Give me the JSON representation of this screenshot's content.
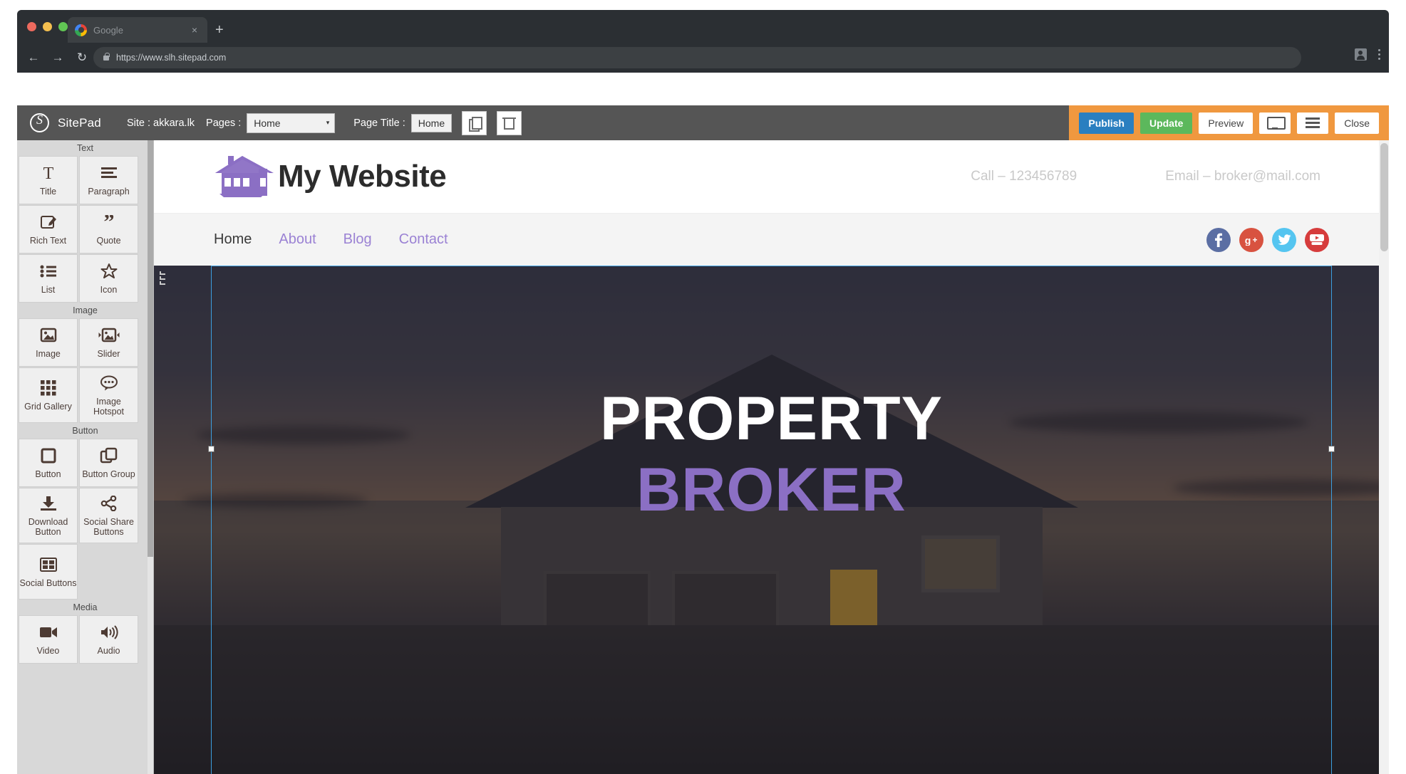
{
  "browser": {
    "tab": {
      "title": "Google",
      "favicon": "google-icon",
      "close": "×"
    },
    "new_tab": "+",
    "back": "←",
    "forward": "→",
    "reload": "↻",
    "url": "https://www.slh.sitepad.com"
  },
  "editor": {
    "brand": "SitePad",
    "site_label": "Site : akkara.lk",
    "pages_label": "Pages :",
    "page_select": {
      "value": "Home",
      "caret": "▾"
    },
    "page_title_label": "Page Title :",
    "page_title_value": "Home",
    "duplicate_icon": "copy-icon",
    "delete_icon": "trash-icon",
    "actions": {
      "publish": "Publish",
      "update": "Update",
      "preview": "Preview",
      "device_icon": "monitor-icon",
      "menu_icon": "hamburger-icon",
      "close": "Close"
    },
    "accent_orange": "#f0983f",
    "publish_color": "#2a7fc0",
    "update_color": "#5cb85c"
  },
  "sidebar": {
    "groups": [
      {
        "title": "Text",
        "items": [
          {
            "label": "Title",
            "icon": "title-icon"
          },
          {
            "label": "Paragraph",
            "icon": "paragraph-icon"
          },
          {
            "label": "Rich Text",
            "icon": "rich-text-icon"
          },
          {
            "label": "Quote",
            "icon": "quote-icon"
          },
          {
            "label": "List",
            "icon": "list-icon"
          },
          {
            "label": "Icon",
            "icon": "star-icon"
          }
        ]
      },
      {
        "title": "Image",
        "items": [
          {
            "label": "Image",
            "icon": "image-icon"
          },
          {
            "label": "Slider",
            "icon": "slider-icon"
          },
          {
            "label": "Grid Gallery",
            "icon": "grid-gallery-icon"
          },
          {
            "label": "Image Hotspot",
            "icon": "hotspot-icon"
          }
        ]
      },
      {
        "title": "Button",
        "items": [
          {
            "label": "Button",
            "icon": "button-icon"
          },
          {
            "label": "Button Group",
            "icon": "button-group-icon"
          },
          {
            "label": "Download Button",
            "icon": "download-icon"
          },
          {
            "label": "Social Share Buttons",
            "icon": "share-icon"
          },
          {
            "label": "Social Buttons",
            "icon": "social-buttons-icon"
          }
        ]
      },
      {
        "title": "Media",
        "items": [
          {
            "label": "Video",
            "icon": "video-icon"
          },
          {
            "label": "Audio",
            "icon": "audio-icon"
          }
        ]
      }
    ]
  },
  "site": {
    "logo_icon": "house-logo",
    "title": "My Website",
    "phone": "Call – 123456789",
    "email": "Email – broker@mail.com",
    "nav": [
      {
        "label": "Home",
        "active": true
      },
      {
        "label": "About",
        "active": false
      },
      {
        "label": "Blog",
        "active": false
      },
      {
        "label": "Contact",
        "active": false
      }
    ],
    "socials": [
      {
        "name": "facebook-icon",
        "glyph": "f",
        "color": "#5b6ea3"
      },
      {
        "name": "google-plus-icon",
        "glyph": "g+",
        "color": "#d85240"
      },
      {
        "name": "twitter-icon",
        "glyph": "ᵗ",
        "color": "#55c5f0"
      },
      {
        "name": "youtube-icon",
        "glyph": "▶",
        "color": "#d63c3c"
      }
    ],
    "hero": {
      "line1": "PROPERTY",
      "line2": "BROKER",
      "line1_color": "#ffffff",
      "line2_color": "#8b6fc4"
    },
    "purple": "#9b82d4"
  }
}
